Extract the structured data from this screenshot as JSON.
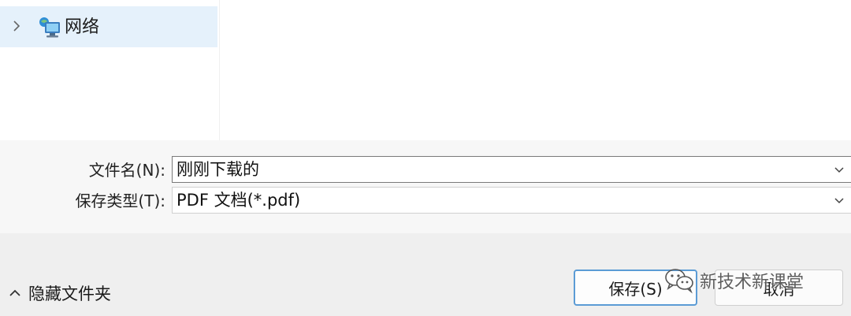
{
  "nav": {
    "items": [
      {
        "label": "网络",
        "icon": "network-icon",
        "selected": true
      }
    ]
  },
  "form": {
    "filename": {
      "label": "文件名(N):",
      "value": "刚刚下载的"
    },
    "filetype": {
      "label": "保存类型(T):",
      "value": "PDF 文档(*.pdf)"
    }
  },
  "footer": {
    "hide_folders_label": "隐藏文件夹",
    "save_label": "保存(S)",
    "cancel_label": "取消"
  },
  "watermark": {
    "text": "新技术新课堂",
    "icon": "wechat-icon"
  },
  "colors": {
    "nav_selected_bg": "#e5f1fb",
    "save_border": "#5b9bd5",
    "field_border": "#7a7a7a"
  }
}
